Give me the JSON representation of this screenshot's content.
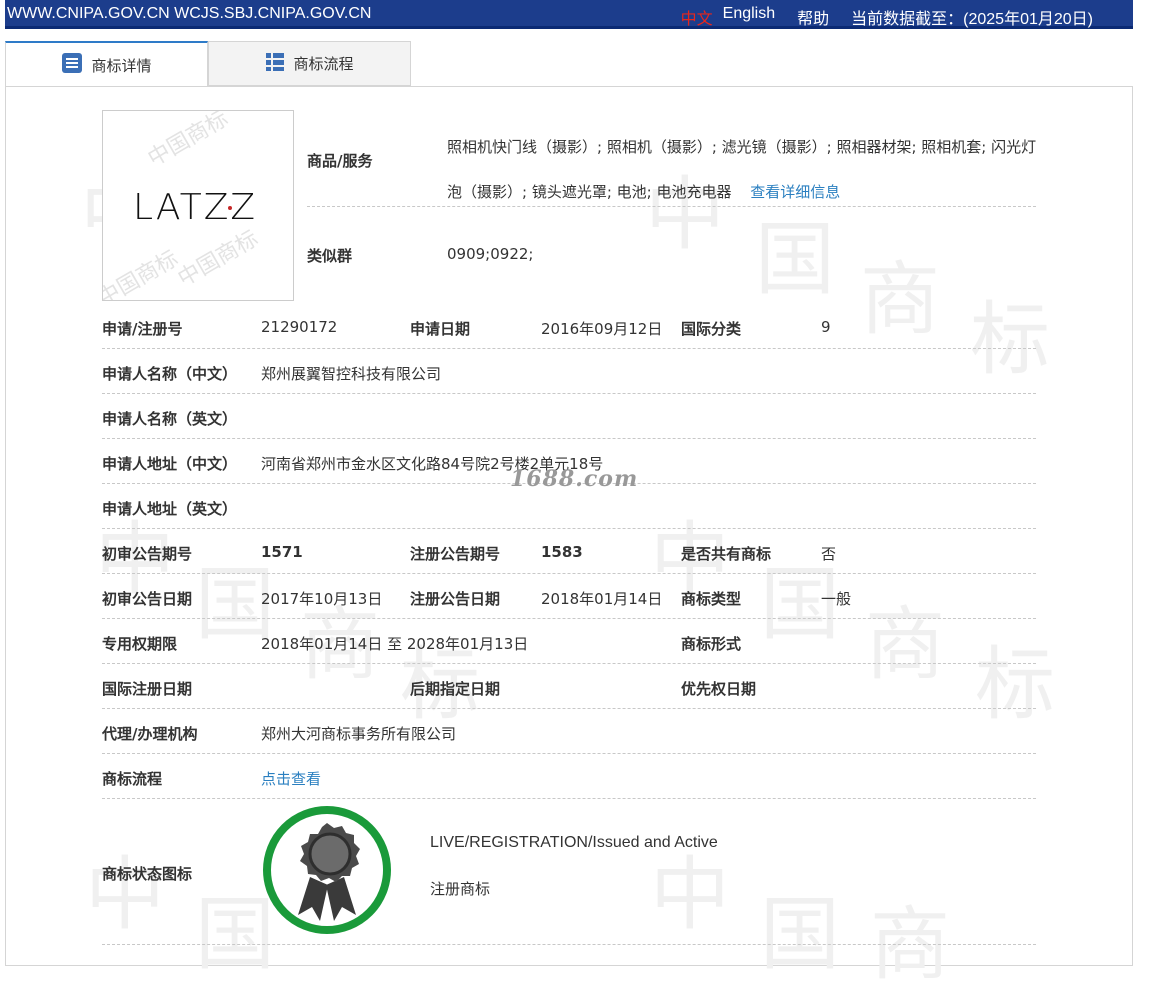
{
  "header": {
    "site_text": "WWW.CNIPA.GOV.CN WCJS.SBJ.CNIPA.GOV.CN",
    "lang_cn": "中文",
    "lang_en": "English",
    "help": "帮助",
    "data_cutoff": "当前数据截至：(2025年01月20日)"
  },
  "tabs": [
    {
      "label": "商标详情",
      "icon": "document-list-icon",
      "active": true
    },
    {
      "label": "商标流程",
      "icon": "grid-list-icon",
      "active": false
    }
  ],
  "logo": {
    "text": "LATZZ"
  },
  "goods": {
    "label": "商品/服务",
    "value": "照相机快门线（摄影）; 照相机（摄影）; 滤光镜（摄影）; 照相器材架; 照相机套; 闪光灯泡（摄影）; 镜头遮光罩; 电池; 电池充电器",
    "more_link": "查看详细信息"
  },
  "similar_group": {
    "label": "类似群",
    "value": "0909;0922;"
  },
  "rows": {
    "reg_no_label": "申请/注册号",
    "reg_no": "21290172",
    "apply_date_label": "申请日期",
    "apply_date": "2016年09月12日",
    "intl_class_label": "国际分类",
    "intl_class": "9",
    "applicant_cn_label": "申请人名称（中文）",
    "applicant_cn": "郑州展翼智控科技有限公司",
    "applicant_en_label": "申请人名称（英文）",
    "applicant_en": "",
    "address_cn_label": "申请人地址（中文）",
    "address_cn": "河南省郑州市金水区文化路84号院2号楼2单元18号",
    "address_en_label": "申请人地址（英文）",
    "address_en": "",
    "prelim_no_label": "初审公告期号",
    "prelim_no": "1571",
    "reg_pub_no_label": "注册公告期号",
    "reg_pub_no": "1583",
    "shared_label": "是否共有商标",
    "shared": "否",
    "prelim_date_label": "初审公告日期",
    "prelim_date": "2017年10月13日",
    "reg_pub_date_label": "注册公告日期",
    "reg_pub_date": "2018年01月14日",
    "tm_type_label": "商标类型",
    "tm_type": "一般",
    "exclusive_label": "专用权期限",
    "exclusive": "2018年01月14日 至 2028年01月13日",
    "tm_form_label": "商标形式",
    "tm_form": "",
    "intl_reg_date_label": "国际注册日期",
    "intl_reg_date": "",
    "later_designation_label": "后期指定日期",
    "later_designation": "",
    "priority_label": "优先权日期",
    "priority": "",
    "agent_label": "代理/办理机构",
    "agent": "郑州大河商标事务所有限公司",
    "process_label": "商标流程",
    "process_link": "点击查看",
    "status_icon_label": "商标状态图标",
    "status_en": "LIVE/REGISTRATION/Issued and Active",
    "status_cn": "注册商标"
  },
  "watermark": {
    "site": "1688.com"
  },
  "colors": {
    "header_bg": "#1c3d8c",
    "link": "#2a7fc0",
    "badge_ring": "#1a9a3a"
  }
}
